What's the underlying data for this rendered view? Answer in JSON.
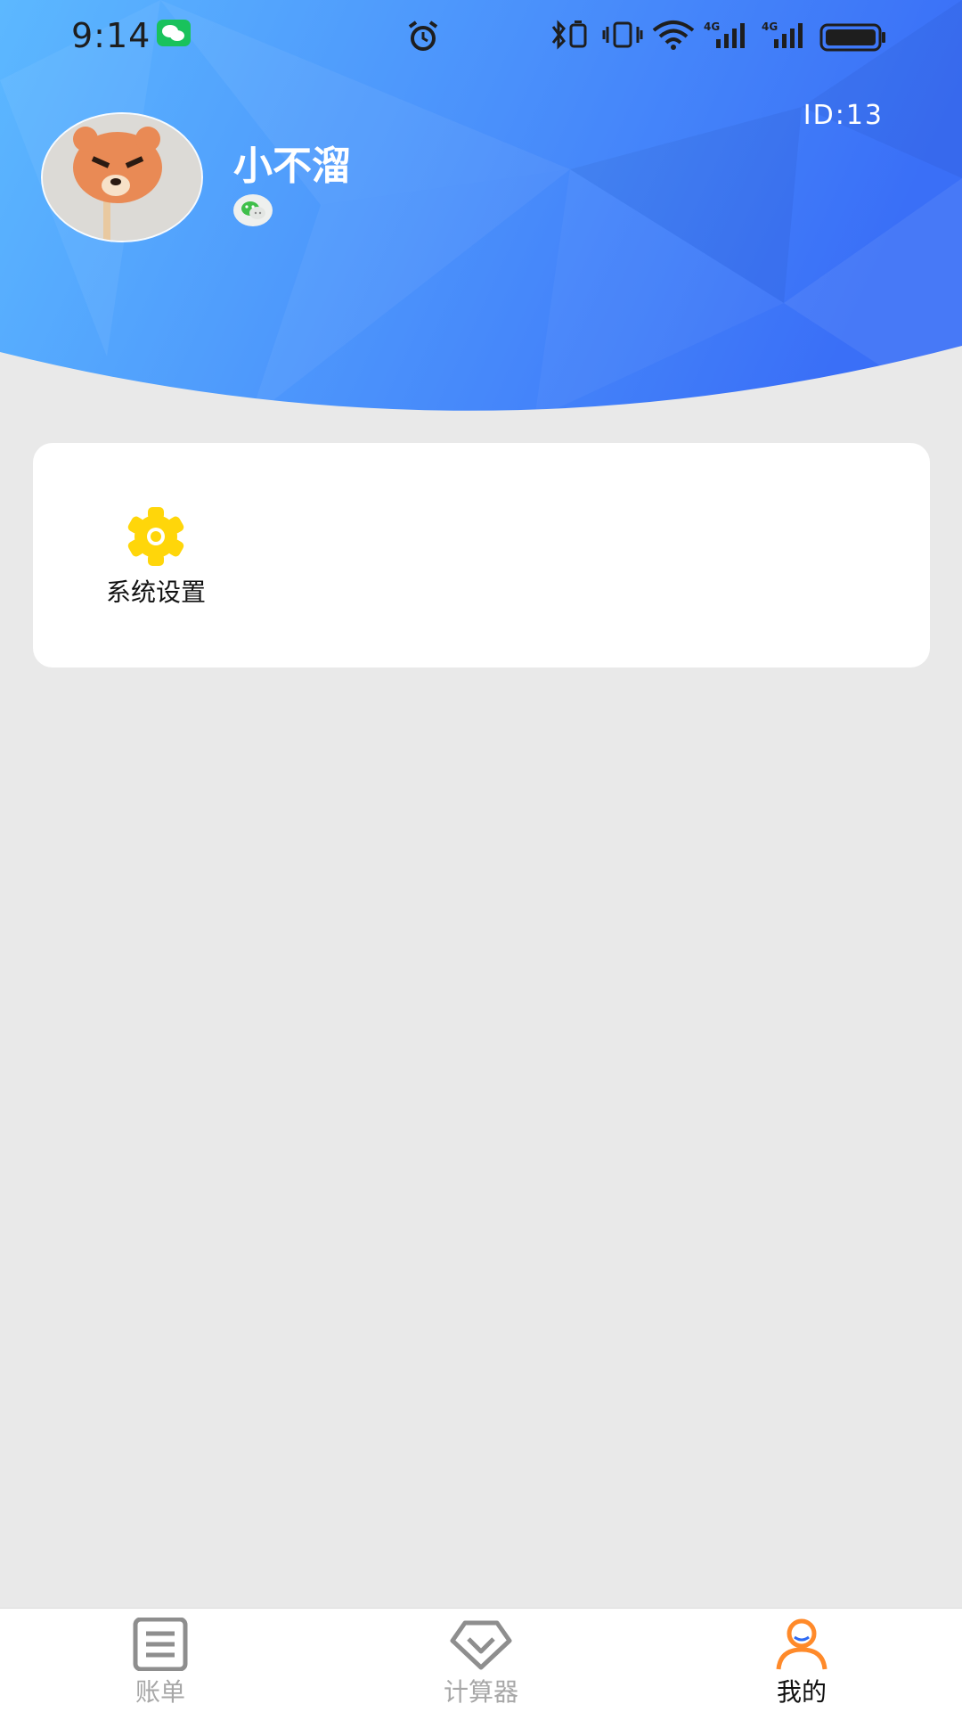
{
  "status_bar": {
    "time": "9:14",
    "icons": [
      "wechat-notification-icon",
      "alarm-icon",
      "bluetooth-icon",
      "vibrate-icon",
      "wifi-icon",
      "signal-4g-icon",
      "signal-4g-icon",
      "battery-icon"
    ]
  },
  "profile": {
    "user_id": "ID:13",
    "nickname": "小不溜",
    "login_badge_icon": "wechat-icon"
  },
  "menu": {
    "items": [
      {
        "label": "系统设置",
        "icon": "gear-icon",
        "color": "#FFD60A"
      }
    ]
  },
  "tab_bar": {
    "tabs": [
      {
        "label": "账单",
        "icon": "bill-list-icon",
        "active": false
      },
      {
        "label": "计算器",
        "icon": "diamond-calculator-icon",
        "active": false
      },
      {
        "label": "我的",
        "icon": "person-icon",
        "active": true
      }
    ],
    "active_color": "#FF8A2A",
    "inactive_color": "#A7A7A7"
  },
  "colors": {
    "header_gradient_start": "#5BB6FF",
    "header_gradient_end": "#3A6FF7",
    "background": "#E9E9E9"
  }
}
